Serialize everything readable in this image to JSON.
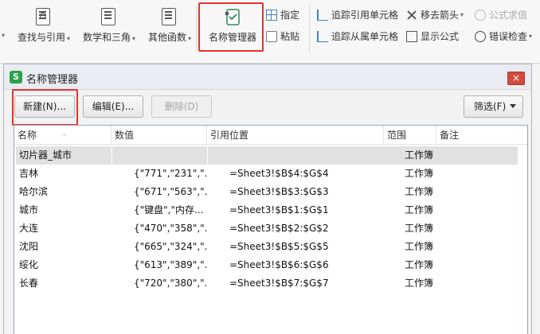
{
  "ribbon": {
    "find_ref": "查找与引用",
    "math_trig": "数学和三角",
    "other_funcs": "其他函数",
    "name_manager": "名称管理器",
    "specify": "指定",
    "paste": "粘贴",
    "trace_precedents": "追踪引用单元格",
    "trace_dependents": "追踪从属单元格",
    "remove_arrows": "移去箭头",
    "show_formulas": "显示公式",
    "evaluate_formula": "公式求值",
    "error_check": "错误检查"
  },
  "dialog": {
    "logo": "S",
    "title": "名称管理器",
    "close": "×",
    "new_button": "新建(N)...",
    "edit_button": "编辑(E)...",
    "delete_button": "删除(D)",
    "filter_button": "筛选(F)"
  },
  "table": {
    "headers": [
      "名称",
      "数值",
      "引用位置",
      "范围",
      "备注"
    ],
    "rows": [
      {
        "name": "切片器_城市",
        "value": "",
        "ref": "",
        "scope": "工作簿"
      },
      {
        "name": "吉林",
        "value": "{\"771\",\"231\",\"...",
        "ref": "=Sheet3!$B$4:$G$4",
        "scope": "工作簿"
      },
      {
        "name": "哈尔滨",
        "value": "{\"671\",\"563\",\"...",
        "ref": "=Sheet3!$B$3:$G$3",
        "scope": "工作簿"
      },
      {
        "name": "城市",
        "value": "{\"键盘\",\"内存...",
        "ref": "=Sheet3!$B$1:$G$1",
        "scope": "工作簿"
      },
      {
        "name": "大连",
        "value": "{\"470\",\"358\",\"...",
        "ref": "=Sheet3!$B$2:$G$2",
        "scope": "工作簿"
      },
      {
        "name": "沈阳",
        "value": "{\"665\",\"324\",\"...",
        "ref": "=Sheet3!$B$5:$G$5",
        "scope": "工作簿"
      },
      {
        "name": "绥化",
        "value": "{\"613\",\"389\",\"...",
        "ref": "=Sheet3!$B$6:$G$6",
        "scope": "工作簿"
      },
      {
        "name": "长春",
        "value": "{\"720\",\"380\",\"...",
        "ref": "=Sheet3!$B$7:$G$7",
        "scope": "工作簿"
      }
    ]
  },
  "colors": {
    "highlight": "#e8322a",
    "app_green": "#2aa14a",
    "close_red": "#d24b3c"
  }
}
